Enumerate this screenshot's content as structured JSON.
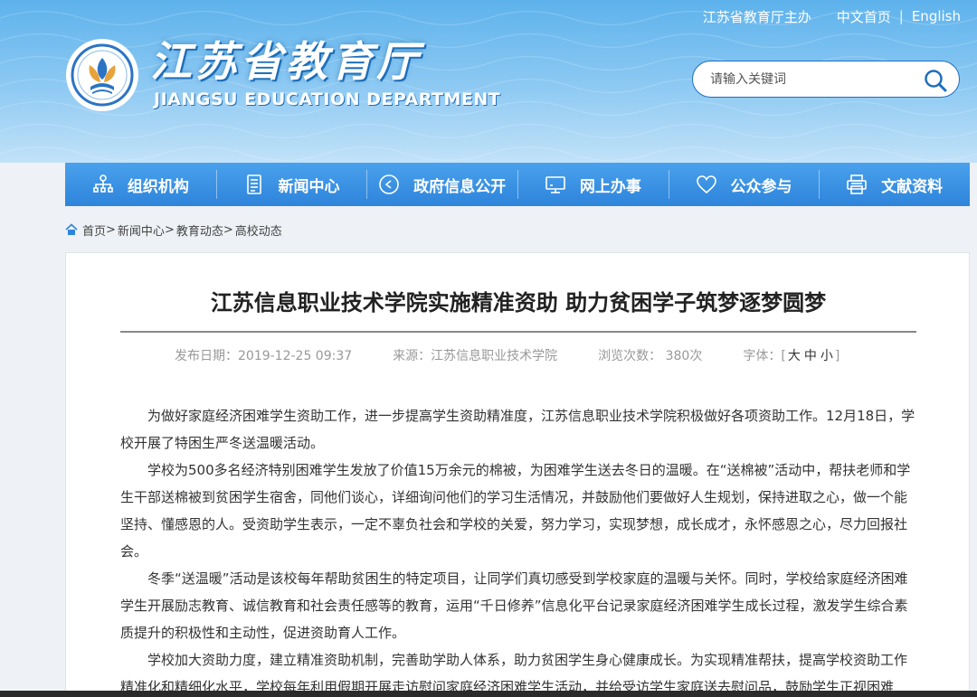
{
  "header": {
    "host_label": "江苏省教育厅主办",
    "home_link": "中文首页",
    "separator": "|",
    "english_link": "English",
    "logo_cn": "江苏省教育厅",
    "logo_en": "JIANGSU EDUCATION DEPARTMENT",
    "search_placeholder": "请输入关键词"
  },
  "nav": {
    "items": [
      {
        "label": "组织机构",
        "icon": "org-chart-icon"
      },
      {
        "label": "新闻中心",
        "icon": "document-icon"
      },
      {
        "label": "政府信息公开",
        "icon": "play-circle-icon"
      },
      {
        "label": "网上办事",
        "icon": "monitor-icon"
      },
      {
        "label": "公众参与",
        "icon": "heart-icon"
      },
      {
        "label": "文献资料",
        "icon": "printer-icon"
      }
    ]
  },
  "breadcrumb": {
    "items": [
      "首页",
      "新闻中心",
      "教育动态",
      "高校动态"
    ],
    "sep": ">"
  },
  "article": {
    "title": "江苏信息职业技术学院实施精准资助 助力贫困学子筑梦逐梦圆梦",
    "publish_date": "发布日期：2019-12-25 09:37",
    "source": "来源：江苏信息职业技术学院",
    "views": "浏览次数： 380次",
    "font_label": "字体：",
    "font_open": "[",
    "font_large": "大",
    "font_medium": "中",
    "font_small": "小",
    "font_close": "]",
    "paragraphs": [
      "为做好家庭经济困难学生资助工作，进一步提高学生资助精准度，江苏信息职业技术学院积极做好各项资助工作。12月18日，学校开展了特困生严冬送温暖活动。",
      "学校为500多名经济特别困难学生发放了价值15万余元的棉被，为困难学生送去冬日的温暖。在“送棉被”活动中，帮扶老师和学生干部送棉被到贫困学生宿舍，同他们谈心，详细询问他们的学习生活情况，并鼓励他们要做好人生规划，保持进取之心，做一个能坚持、懂感恩的人。受资助学生表示，一定不辜负社会和学校的关爱，努力学习，实现梦想，成长成才，永怀感恩之心，尽力回报社会。",
      "冬季“送温暖”活动是该校每年帮助贫困生的特定项目，让同学们真切感受到学校家庭的温暖与关怀。同时，学校给家庭经济困难学生开展励志教育、诚信教育和社会责任感等的教育，运用“千日修养”信息化平台记录家庭经济困难学生成长过程，激发学生综合素质提升的积极性和主动性，促进资助育人工作。",
      "学校加大资助力度，建立精准资助机制，完善助学助人体系，助力贫困学生身心健康成长。为实现精准帮扶，提高学校资助工作精准化和精细化水平，学校每年利用假期开展走访慰问家庭经济困难学生活动，并给受访学生家庭送去慰问品，鼓励学生正视困难"
    ]
  },
  "colors": {
    "header_top": "#5db2ec",
    "nav_blue": "#2d84db",
    "search_border": "#1f6fc0"
  }
}
